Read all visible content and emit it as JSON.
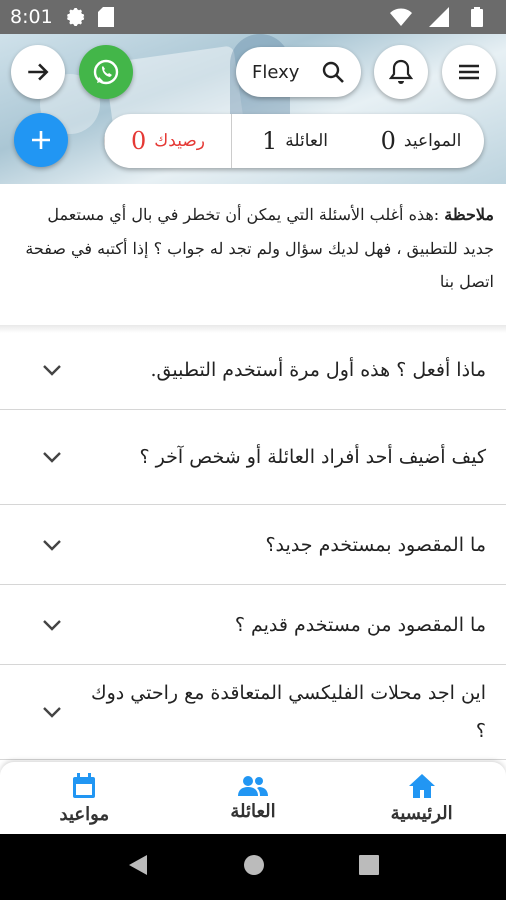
{
  "status_bar": {
    "time": "8:01",
    "icons_left": [
      "settings-icon",
      "sim-card-icon"
    ],
    "icons_right": [
      "wifi-icon",
      "signal-icon",
      "battery-icon"
    ]
  },
  "header": {
    "search": {
      "label": "Flexy",
      "icon": "search-icon"
    },
    "buttons": [
      "forward-arrow-icon",
      "whatsapp-icon",
      "bell-icon",
      "menu-icon"
    ],
    "whatsapp_color": "#43b649"
  },
  "stats": [
    {
      "label": "رصيدك",
      "value": "0",
      "color": "#e53935"
    },
    {
      "label": "العائلة",
      "value": "1"
    },
    {
      "label": "المواعيد",
      "value": "0"
    }
  ],
  "add_button_color": "#2196f3",
  "note": {
    "label": "ملاحظة",
    "text": ":هذه أغلب الأسئلة التي يمكن أن تخطر في بال أي مستعمل جديد للتطبيق ، فهل لديك سؤال ولم تجد له جواب ؟ إذا أكتبه في صفحة اتصل بنا"
  },
  "faq": [
    {
      "question": "ماذا أفعل ؟ هذه أول مرة أستخدم التطبيق."
    },
    {
      "question": "كيف أضيف أحد أفراد العائلة أو شخص آخر ؟"
    },
    {
      "question": "ما المقصود بمستخدم جديد؟"
    },
    {
      "question": "ما المقصود من مستخدم قديم ؟"
    },
    {
      "question": "اين اجد محلات الفليكسي المتعاقدة مع راحتي دوك ؟"
    }
  ],
  "bottom_nav": [
    {
      "label": "مواعيد",
      "icon": "calendar-icon"
    },
    {
      "label": "العائلة",
      "icon": "family-icon"
    },
    {
      "label": "الرئيسية",
      "icon": "home-icon"
    }
  ],
  "nav_icon_color": "#2196f3",
  "android_nav": [
    "back-icon",
    "home-circle-icon",
    "recents-icon"
  ]
}
